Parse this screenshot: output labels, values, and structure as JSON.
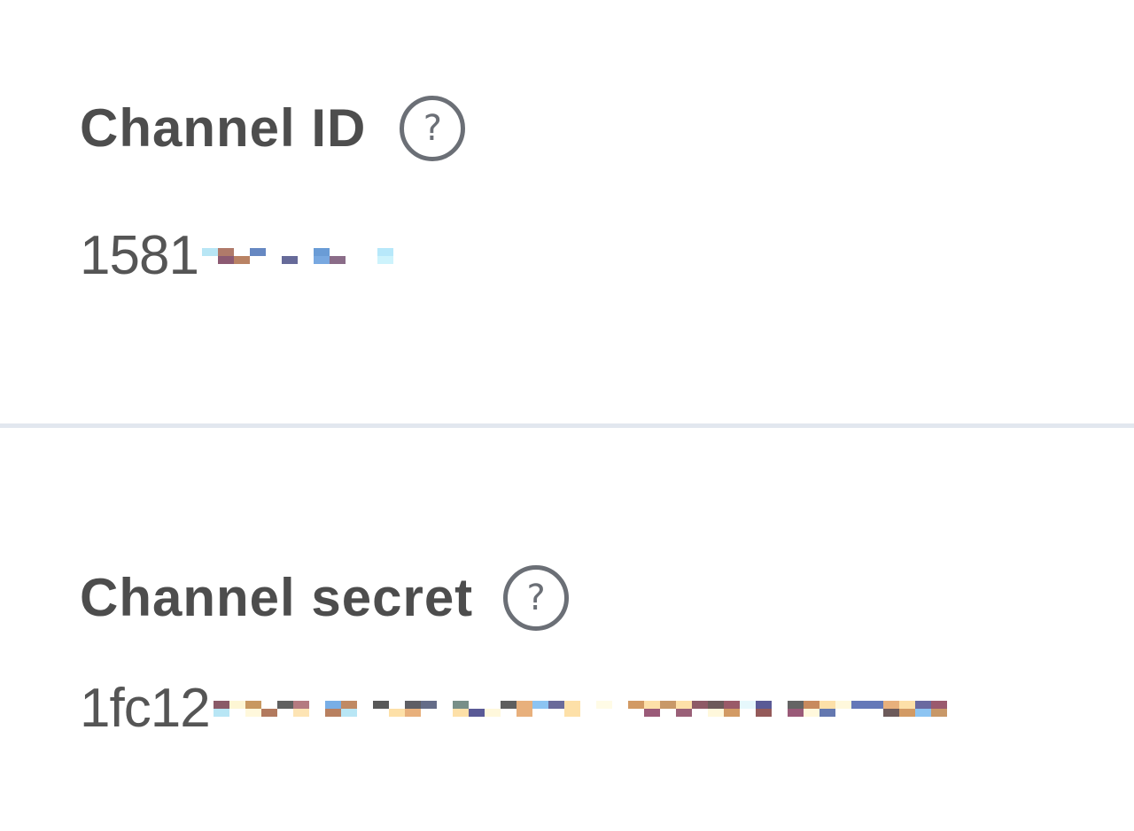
{
  "channel_id": {
    "label": "Channel ID",
    "help_icon": "question-circle-icon",
    "value_visible": "1581",
    "value_masked": true
  },
  "channel_secret": {
    "label": "Channel secret",
    "help_icon": "question-circle-icon",
    "value_visible": "1fc12",
    "value_masked": true
  },
  "colors": {
    "text": "#4d4d4d",
    "icon": "#6b6f76",
    "divider": "#e2e7ef",
    "background": "#ffffff"
  }
}
